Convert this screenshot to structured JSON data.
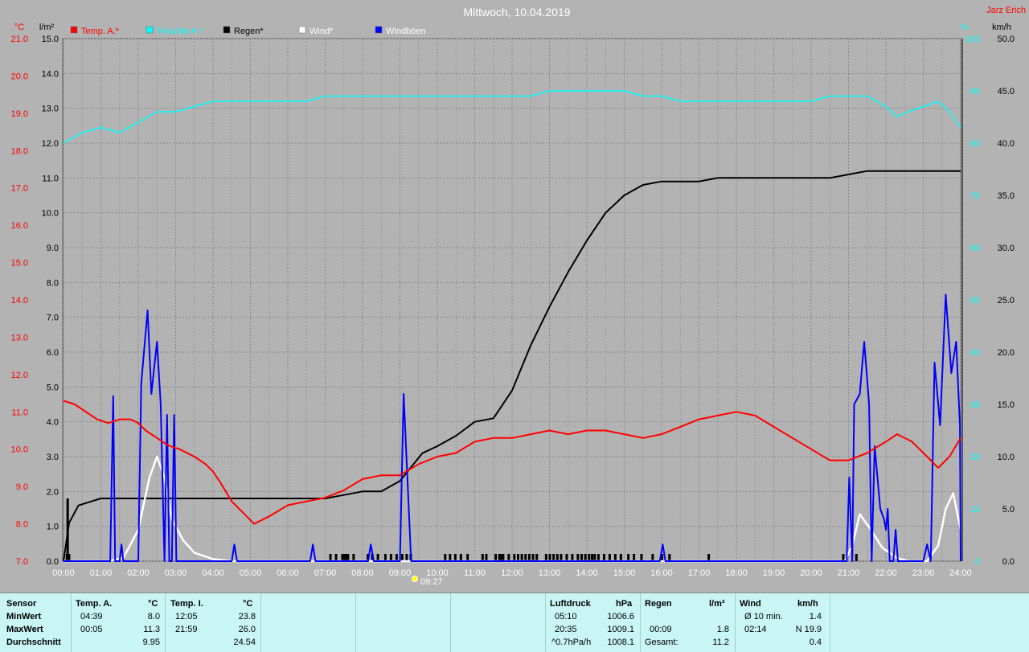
{
  "header": {
    "title": "Mittwoch, 10.04.2019",
    "author": "Jarz Erich"
  },
  "legend": [
    {
      "label": "Temp. A.*",
      "color": "#ff0000"
    },
    {
      "label": "Feuchte A.*",
      "color": "#00ffff"
    },
    {
      "label": "Regen*",
      "color": "#000000"
    },
    {
      "label": "Wind*",
      "color": "#ffffff"
    },
    {
      "label": "Windböen",
      "color": "#0000ff"
    }
  ],
  "axes": {
    "unit_temp": "°C",
    "unit_rain": "l/m²",
    "unit_hum": "%",
    "unit_wind": "km/h",
    "temp_ticks": [
      "21.0",
      "20.0",
      "19.0",
      "18.0",
      "17.0",
      "16.0",
      "15.0",
      "14.0",
      "13.0",
      "12.0",
      "11.0",
      "10.0",
      "9.0",
      "8.0",
      "7.0"
    ],
    "rain_ticks": [
      "15.0",
      "14.0",
      "13.0",
      "12.0",
      "11.0",
      "10.0",
      "9.0",
      "8.0",
      "7.0",
      "6.0",
      "5.0",
      "4.0",
      "3.0",
      "2.0",
      "1.0",
      "0.0"
    ],
    "hum_ticks": [
      "100",
      "90",
      "80",
      "70",
      "60",
      "50",
      "40",
      "30",
      "20",
      "10",
      "0"
    ],
    "wind_ticks": [
      "50.0",
      "45.0",
      "40.0",
      "35.0",
      "30.0",
      "25.0",
      "20.0",
      "15.0",
      "10.0",
      "5.0",
      "0.0"
    ],
    "time_ticks": [
      "00:00",
      "01:00",
      "02:00",
      "03:00",
      "04:00",
      "05:00",
      "06:00",
      "07:00",
      "08:00",
      "09:00",
      "10:00",
      "11:00",
      "12:00",
      "13:00",
      "14:00",
      "15:00",
      "16:00",
      "17:00",
      "18:00",
      "19:00",
      "20:00",
      "21:00",
      "22:00",
      "23:00",
      "24:00"
    ],
    "sun_marker": "09:27"
  },
  "chart_data": {
    "type": "line",
    "x_unit": "hours",
    "xlim": [
      0,
      24
    ],
    "temp_ylim": [
      7,
      21
    ],
    "rain_ylim": [
      0,
      15
    ],
    "hum_ylim": [
      0,
      100
    ],
    "wind_ylim": [
      0,
      50
    ],
    "grid": true,
    "series": [
      {
        "name": "Temp. A.*",
        "axis": "temp",
        "color": "#ff0000",
        "points": [
          [
            0,
            11.3
          ],
          [
            0.3,
            11.2
          ],
          [
            0.6,
            11.0
          ],
          [
            0.9,
            10.8
          ],
          [
            1.2,
            10.7
          ],
          [
            1.5,
            10.8
          ],
          [
            1.8,
            10.8
          ],
          [
            2.0,
            10.7
          ],
          [
            2.2,
            10.5
          ],
          [
            2.5,
            10.3
          ],
          [
            2.8,
            10.1
          ],
          [
            3.1,
            10.0
          ],
          [
            3.5,
            9.8
          ],
          [
            3.8,
            9.6
          ],
          [
            4.0,
            9.4
          ],
          [
            4.2,
            9.1
          ],
          [
            4.5,
            8.6
          ],
          [
            4.8,
            8.3
          ],
          [
            5.1,
            8.0
          ],
          [
            5.5,
            8.2
          ],
          [
            6.0,
            8.5
          ],
          [
            6.5,
            8.6
          ],
          [
            7.0,
            8.7
          ],
          [
            7.5,
            8.9
          ],
          [
            8.0,
            9.2
          ],
          [
            8.5,
            9.3
          ],
          [
            9.0,
            9.3
          ],
          [
            9.5,
            9.6
          ],
          [
            10.0,
            9.8
          ],
          [
            10.5,
            9.9
          ],
          [
            11.0,
            10.2
          ],
          [
            11.5,
            10.3
          ],
          [
            12.0,
            10.3
          ],
          [
            12.5,
            10.4
          ],
          [
            13.0,
            10.5
          ],
          [
            13.5,
            10.4
          ],
          [
            14.0,
            10.5
          ],
          [
            14.5,
            10.5
          ],
          [
            15.0,
            10.4
          ],
          [
            15.5,
            10.3
          ],
          [
            16.0,
            10.4
          ],
          [
            16.5,
            10.6
          ],
          [
            17.0,
            10.8
          ],
          [
            17.5,
            10.9
          ],
          [
            18.0,
            11.0
          ],
          [
            18.5,
            10.9
          ],
          [
            19.0,
            10.6
          ],
          [
            19.5,
            10.3
          ],
          [
            20.0,
            10.0
          ],
          [
            20.5,
            9.7
          ],
          [
            21.0,
            9.7
          ],
          [
            21.5,
            9.9
          ],
          [
            22.0,
            10.2
          ],
          [
            22.3,
            10.4
          ],
          [
            22.7,
            10.2
          ],
          [
            23.1,
            9.8
          ],
          [
            23.4,
            9.5
          ],
          [
            23.7,
            9.8
          ],
          [
            24,
            10.3
          ]
        ]
      },
      {
        "name": "Feuchte A.*",
        "axis": "hum",
        "color": "#00ffff",
        "points": [
          [
            0,
            80
          ],
          [
            0.5,
            82
          ],
          [
            1.0,
            83
          ],
          [
            1.5,
            82
          ],
          [
            2.0,
            84
          ],
          [
            2.5,
            86
          ],
          [
            3.0,
            86
          ],
          [
            3.5,
            87
          ],
          [
            4.0,
            88
          ],
          [
            4.5,
            88
          ],
          [
            5.0,
            88
          ],
          [
            5.5,
            88
          ],
          [
            6.0,
            88
          ],
          [
            6.5,
            88
          ],
          [
            7.0,
            89
          ],
          [
            7.5,
            89
          ],
          [
            8.0,
            89
          ],
          [
            8.5,
            89
          ],
          [
            9.0,
            89
          ],
          [
            9.5,
            89
          ],
          [
            10.0,
            89
          ],
          [
            10.5,
            89
          ],
          [
            11.0,
            89
          ],
          [
            11.5,
            89
          ],
          [
            12.0,
            89
          ],
          [
            12.5,
            89
          ],
          [
            13.0,
            90
          ],
          [
            13.5,
            90
          ],
          [
            14.0,
            90
          ],
          [
            14.5,
            90
          ],
          [
            15.0,
            90
          ],
          [
            15.5,
            89
          ],
          [
            16.0,
            89
          ],
          [
            16.5,
            88
          ],
          [
            17.0,
            88
          ],
          [
            17.5,
            88
          ],
          [
            18.0,
            88
          ],
          [
            18.5,
            88
          ],
          [
            19.0,
            88
          ],
          [
            19.5,
            88
          ],
          [
            20.0,
            88
          ],
          [
            20.5,
            89
          ],
          [
            21.0,
            89
          ],
          [
            21.5,
            89
          ],
          [
            22.0,
            87
          ],
          [
            22.3,
            85
          ],
          [
            22.6,
            86
          ],
          [
            23.0,
            87
          ],
          [
            23.4,
            88
          ],
          [
            23.7,
            86
          ],
          [
            24,
            83
          ]
        ]
      },
      {
        "name": "Regen*",
        "axis": "rain",
        "color": "#000000",
        "points": [
          [
            0,
            0
          ],
          [
            0.15,
            1.1
          ],
          [
            0.4,
            1.6
          ],
          [
            0.7,
            1.7
          ],
          [
            1.0,
            1.8
          ],
          [
            2.0,
            1.8
          ],
          [
            3.0,
            1.8
          ],
          [
            4.0,
            1.8
          ],
          [
            5.0,
            1.8
          ],
          [
            6.0,
            1.8
          ],
          [
            7.0,
            1.8
          ],
          [
            7.5,
            1.9
          ],
          [
            8.0,
            2.0
          ],
          [
            8.5,
            2.0
          ],
          [
            9.0,
            2.3
          ],
          [
            9.3,
            2.7
          ],
          [
            9.6,
            3.1
          ],
          [
            10.0,
            3.3
          ],
          [
            10.5,
            3.6
          ],
          [
            11.0,
            4.0
          ],
          [
            11.5,
            4.1
          ],
          [
            12.0,
            4.9
          ],
          [
            12.5,
            6.2
          ],
          [
            13.0,
            7.3
          ],
          [
            13.5,
            8.3
          ],
          [
            14.0,
            9.2
          ],
          [
            14.5,
            10.0
          ],
          [
            15.0,
            10.5
          ],
          [
            15.5,
            10.8
          ],
          [
            16.0,
            10.9
          ],
          [
            16.5,
            10.9
          ],
          [
            17.0,
            10.9
          ],
          [
            17.5,
            11.0
          ],
          [
            18.0,
            11.0
          ],
          [
            18.5,
            11.0
          ],
          [
            19.0,
            11.0
          ],
          [
            20.0,
            11.0
          ],
          [
            20.5,
            11.0
          ],
          [
            21.0,
            11.1
          ],
          [
            21.5,
            11.2
          ],
          [
            22.0,
            11.2
          ],
          [
            23.0,
            11.2
          ],
          [
            24,
            11.2
          ]
        ]
      },
      {
        "name": "Wind*",
        "axis": "wind",
        "color": "#ffffff",
        "points": [
          [
            0,
            0
          ],
          [
            1.2,
            0
          ],
          [
            1.6,
            0.3
          ],
          [
            2.0,
            3
          ],
          [
            2.3,
            8
          ],
          [
            2.5,
            10
          ],
          [
            2.7,
            8
          ],
          [
            2.9,
            4
          ],
          [
            3.2,
            2
          ],
          [
            3.5,
            0.8
          ],
          [
            4.0,
            0.2
          ],
          [
            4.5,
            0
          ],
          [
            20.9,
            0
          ],
          [
            21.1,
            1.5
          ],
          [
            21.3,
            4.5
          ],
          [
            21.6,
            3
          ],
          [
            21.9,
            1.3
          ],
          [
            22.3,
            0.3
          ],
          [
            22.6,
            0
          ],
          [
            23.1,
            0
          ],
          [
            23.4,
            1.5
          ],
          [
            23.6,
            5
          ],
          [
            23.8,
            6.5
          ],
          [
            24,
            3
          ]
        ]
      },
      {
        "name": "Windböen",
        "axis": "wind",
        "color": "#0000ff",
        "points": [
          [
            0,
            0
          ],
          [
            1.25,
            0
          ],
          [
            1.33,
            15.8
          ],
          [
            1.38,
            0
          ],
          [
            1.5,
            0
          ],
          [
            1.55,
            1.6
          ],
          [
            1.6,
            0
          ],
          [
            2.0,
            0
          ],
          [
            2.08,
            17
          ],
          [
            2.25,
            24
          ],
          [
            2.35,
            16
          ],
          [
            2.5,
            21
          ],
          [
            2.6,
            15
          ],
          [
            2.7,
            0
          ],
          [
            2.77,
            14
          ],
          [
            2.83,
            0
          ],
          [
            2.9,
            0
          ],
          [
            2.96,
            14
          ],
          [
            3.02,
            0
          ],
          [
            4.5,
            0
          ],
          [
            4.57,
            1.6
          ],
          [
            4.64,
            0
          ],
          [
            6.6,
            0
          ],
          [
            6.67,
            1.6
          ],
          [
            6.74,
            0
          ],
          [
            8.15,
            0
          ],
          [
            8.22,
            1.6
          ],
          [
            8.3,
            0
          ],
          [
            9.0,
            0
          ],
          [
            9.1,
            16
          ],
          [
            9.3,
            0
          ],
          [
            15.95,
            0
          ],
          [
            16.03,
            1.6
          ],
          [
            16.1,
            0
          ],
          [
            20.95,
            0
          ],
          [
            21.02,
            8
          ],
          [
            21.1,
            0
          ],
          [
            21.15,
            15
          ],
          [
            21.3,
            16
          ],
          [
            21.42,
            21
          ],
          [
            21.55,
            15
          ],
          [
            21.62,
            0
          ],
          [
            21.7,
            11
          ],
          [
            21.85,
            5
          ],
          [
            21.95,
            4
          ],
          [
            22.0,
            3
          ],
          [
            22.05,
            5
          ],
          [
            22.1,
            0
          ],
          [
            22.2,
            0
          ],
          [
            22.26,
            3
          ],
          [
            22.32,
            0
          ],
          [
            23.0,
            0
          ],
          [
            23.1,
            1.6
          ],
          [
            23.2,
            0
          ],
          [
            23.3,
            19
          ],
          [
            23.45,
            13
          ],
          [
            23.6,
            25.5
          ],
          [
            23.75,
            18
          ],
          [
            23.88,
            21
          ],
          [
            23.98,
            13
          ],
          [
            24,
            0
          ]
        ]
      }
    ],
    "rain_bars": [
      0.08,
      0.1,
      0.12,
      0.14,
      7.13,
      7.28,
      7.45,
      7.5,
      7.55,
      7.6,
      7.75,
      8.13,
      8.25,
      8.4,
      8.6,
      8.75,
      8.9,
      9.05,
      9.17,
      9.28,
      10.2,
      10.33,
      10.47,
      10.62,
      10.8,
      11.2,
      11.3,
      11.55,
      11.65,
      11.7,
      11.75,
      11.9,
      12.05,
      12.15,
      12.25,
      12.35,
      12.45,
      12.55,
      12.65,
      12.9,
      13.0,
      13.1,
      13.2,
      13.3,
      13.45,
      13.6,
      13.75,
      13.85,
      13.95,
      14.05,
      14.13,
      14.2,
      14.3,
      14.45,
      14.6,
      14.75,
      14.9,
      15.1,
      15.25,
      15.45,
      15.75,
      16.0,
      16.2,
      17.25,
      20.85,
      21.2
    ],
    "stats": {
      "temp_a": {
        "label": "Temp. A.",
        "unit": "°C",
        "min_time": "04:39",
        "min": "8.0",
        "max_time": "00:05",
        "max": "11.3",
        "avg": "9.95"
      },
      "temp_i": {
        "label": "Temp. I.",
        "unit": "°C",
        "min_time": "12:05",
        "min": "23.8",
        "max_time": "21:59",
        "max": "26.0",
        "avg": "24.54"
      },
      "pressure": {
        "label": "Luftdruck",
        "unit": "hPa",
        "min_time": "05:10",
        "min": "1006.6",
        "max_time": "20:35",
        "max": "1009.1",
        "avg_label": "^0.7hPa/h",
        "avg": "1008.1"
      },
      "rain": {
        "label": "Regen",
        "unit": "l/m²",
        "max_time": "00:09",
        "max": "1.8",
        "total_label": "Gesamt:",
        "total": "11.2"
      },
      "wind": {
        "label": "Wind",
        "unit": "km/h",
        "avg_label": "Ø 10 min.",
        "avg": "1.4",
        "max_time": "02:14",
        "max": "N 19.9",
        "mean": "0.4"
      }
    }
  },
  "stats_labels": {
    "sensor": "Sensor",
    "min": "MinWert",
    "max": "MaxWert",
    "avg": "Durchschnitt"
  }
}
